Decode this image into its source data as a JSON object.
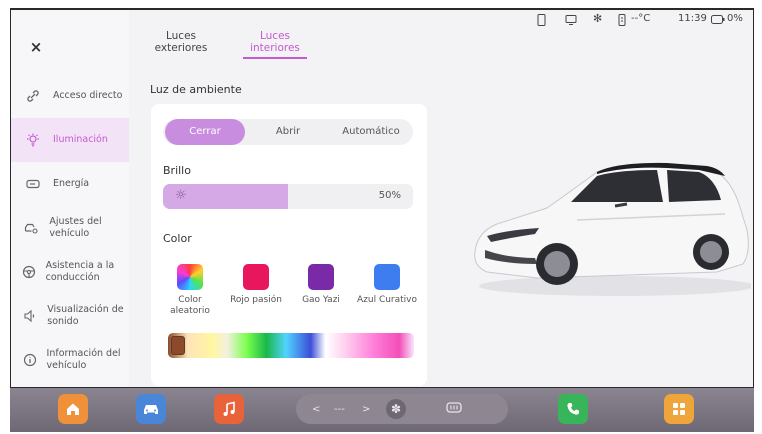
{
  "colors": {
    "accent": "#c45bd0",
    "accent_light": "#d5a9e6",
    "segment_active": "#c98de0",
    "dock_bg": "#7a737f"
  },
  "status_bar": {
    "temperature": "--°C",
    "time": "11:39",
    "battery": "0%"
  },
  "sidebar": {
    "close_label": "×",
    "items": [
      {
        "label": "Acceso directo",
        "icon": "link-icon"
      },
      {
        "label": "Iluminación",
        "icon": "light-icon",
        "active": true
      },
      {
        "label": "Energía",
        "icon": "battery-icon"
      },
      {
        "label": "Ajustes del vehículo",
        "icon": "car-settings-icon"
      },
      {
        "label": "Asistencia a la conducción",
        "icon": "steering-wheel-icon"
      },
      {
        "label": "Visualización de sonido",
        "icon": "speaker-icon"
      },
      {
        "label": "Información del vehículo",
        "icon": "info-icon"
      }
    ]
  },
  "tabs": [
    {
      "label": "Luces exteriores"
    },
    {
      "label": "Luces interiores",
      "active": true
    }
  ],
  "main": {
    "section_title": "Luz de ambiente",
    "mode_options": [
      "Cerrar",
      "Abrir",
      "Automático"
    ],
    "mode_selected": "Cerrar",
    "brightness_label": "Brillo",
    "brightness_value": "50%",
    "brightness_fraction": 0.5,
    "color_label": "Color",
    "colors": [
      {
        "label": "Color aleatorio",
        "swatch": "rainbow"
      },
      {
        "label": "Rojo pasión",
        "swatch": "#e8175d"
      },
      {
        "label": "Gao Yazi",
        "swatch": "#7a2aa6"
      },
      {
        "label": "Azul Curativo",
        "swatch": "#3d7df0"
      }
    ]
  },
  "dock": {
    "items": [
      "home-icon",
      "car-icon",
      "music-icon",
      "phone-icon",
      "apps-icon"
    ],
    "climate": {
      "left": "<",
      "center": "---",
      "right": ">"
    }
  }
}
